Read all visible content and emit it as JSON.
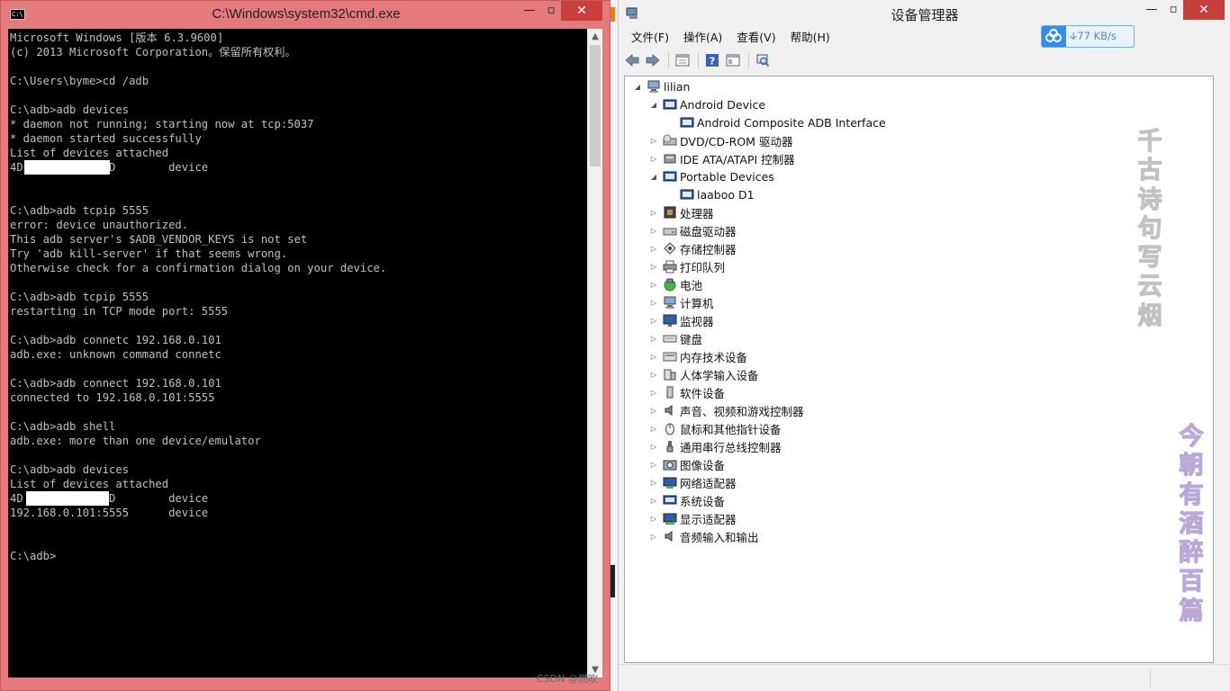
{
  "cmd": {
    "title": "C:\\Windows\\system32\\cmd.exe",
    "icon_text": "C:\\",
    "buttons": {
      "minimize": "—",
      "maximize": "▫",
      "close": "✕"
    },
    "lines": [
      "Microsoft Windows [版本 6.3.9600]",
      "(c) 2013 Microsoft Corporation。保留所有权利。",
      "",
      "C:\\Users\\byme>cd /adb",
      "",
      "C:\\adb>adb devices",
      "* daemon not running; starting now at tcp:5037",
      "* daemon started successfully",
      "List of devices attached",
      "4D            5D        device",
      "",
      "",
      "C:\\adb>adb tcpip 5555",
      "error: device unauthorized.",
      "This adb server's $ADB_VENDOR_KEYS is not set",
      "Try 'adb kill-server' if that seems wrong.",
      "Otherwise check for a confirmation dialog on your device.",
      "",
      "C:\\adb>adb tcpip 5555",
      "restarting in TCP mode port: 5555",
      "",
      "C:\\adb>adb connetc 192.168.0.101",
      "adb.exe: unknown command connetc",
      "",
      "C:\\adb>adb connect 192.168.0.101",
      "connected to 192.168.0.101:5555",
      "",
      "C:\\adb>adb shell",
      "adb.exe: more than one device/emulator",
      "",
      "C:\\adb>adb devices",
      "List of devices attached",
      "4D            5D        device",
      "192.168.0.101:5555      device",
      "",
      "",
      "C:\\adb>"
    ]
  },
  "devmgr": {
    "title": "设备管理器",
    "buttons": {
      "minimize": "—",
      "maximize": "▫",
      "close": "✕"
    },
    "menu": [
      "文件(F)",
      "操作(A)",
      "查看(V)",
      "帮助(H)"
    ],
    "net_speed": "77 KB/s",
    "toolbar_icons": [
      "back-arrow-icon",
      "forward-arrow-icon",
      "properties-icon",
      "help-icon",
      "view-icon",
      "scan-hardware-icon"
    ],
    "tree": {
      "root": {
        "label": "lilian",
        "icon": "computer-icon"
      },
      "items": [
        {
          "label": "Android Device",
          "expanded": true,
          "level": 1,
          "icon": "android-device-icon"
        },
        {
          "label": "Android Composite ADB Interface",
          "level": 2,
          "icon": "adb-interface-icon"
        },
        {
          "label": "DVD/CD-ROM 驱动器",
          "expanded": false,
          "level": 1,
          "icon": "dvd-drive-icon"
        },
        {
          "label": "IDE ATA/ATAPI 控制器",
          "expanded": false,
          "level": 1,
          "icon": "ide-controller-icon"
        },
        {
          "label": "Portable Devices",
          "expanded": true,
          "level": 1,
          "icon": "portable-devices-icon"
        },
        {
          "label": "laaboo D1",
          "level": 2,
          "icon": "portable-device-icon"
        },
        {
          "label": "处理器",
          "expanded": false,
          "level": 1,
          "icon": "processor-icon"
        },
        {
          "label": "磁盘驱动器",
          "expanded": false,
          "level": 1,
          "icon": "disk-drive-icon"
        },
        {
          "label": "存储控制器",
          "expanded": false,
          "level": 1,
          "icon": "storage-controller-icon"
        },
        {
          "label": "打印队列",
          "expanded": false,
          "level": 1,
          "icon": "printer-icon"
        },
        {
          "label": "电池",
          "expanded": false,
          "level": 1,
          "icon": "battery-icon"
        },
        {
          "label": "计算机",
          "expanded": false,
          "level": 1,
          "icon": "computer-icon"
        },
        {
          "label": "监视器",
          "expanded": false,
          "level": 1,
          "icon": "monitor-icon"
        },
        {
          "label": "键盘",
          "expanded": false,
          "level": 1,
          "icon": "keyboard-icon"
        },
        {
          "label": "内存技术设备",
          "expanded": false,
          "level": 1,
          "icon": "memory-device-icon"
        },
        {
          "label": "人体学输入设备",
          "expanded": false,
          "level": 1,
          "icon": "hid-icon"
        },
        {
          "label": "软件设备",
          "expanded": false,
          "level": 1,
          "icon": "software-device-icon"
        },
        {
          "label": "声音、视频和游戏控制器",
          "expanded": false,
          "level": 1,
          "icon": "sound-icon"
        },
        {
          "label": "鼠标和其他指针设备",
          "expanded": false,
          "level": 1,
          "icon": "mouse-icon"
        },
        {
          "label": "通用串行总线控制器",
          "expanded": false,
          "level": 1,
          "icon": "usb-icon"
        },
        {
          "label": "图像设备",
          "expanded": false,
          "level": 1,
          "icon": "camera-icon"
        },
        {
          "label": "网络适配器",
          "expanded": false,
          "level": 1,
          "icon": "network-adapter-icon"
        },
        {
          "label": "系统设备",
          "expanded": false,
          "level": 1,
          "icon": "system-device-icon"
        },
        {
          "label": "显示适配器",
          "expanded": false,
          "level": 1,
          "icon": "display-adapter-icon"
        },
        {
          "label": "音频输入和输出",
          "expanded": false,
          "level": 1,
          "icon": "audio-io-icon"
        }
      ]
    }
  },
  "watermarks": {
    "poem_line_1": "千古诗句写云烟",
    "poem_line_2": "今朝有酒醉百篇",
    "csdn": "CSDN @燃吹"
  },
  "colors": {
    "cmd_frame": "#e47a7c",
    "cmd_close": "#c7403e",
    "console_bg": "#000000",
    "console_text": "#c0c0c0",
    "netbadge_accent": "#2f8ef0"
  }
}
